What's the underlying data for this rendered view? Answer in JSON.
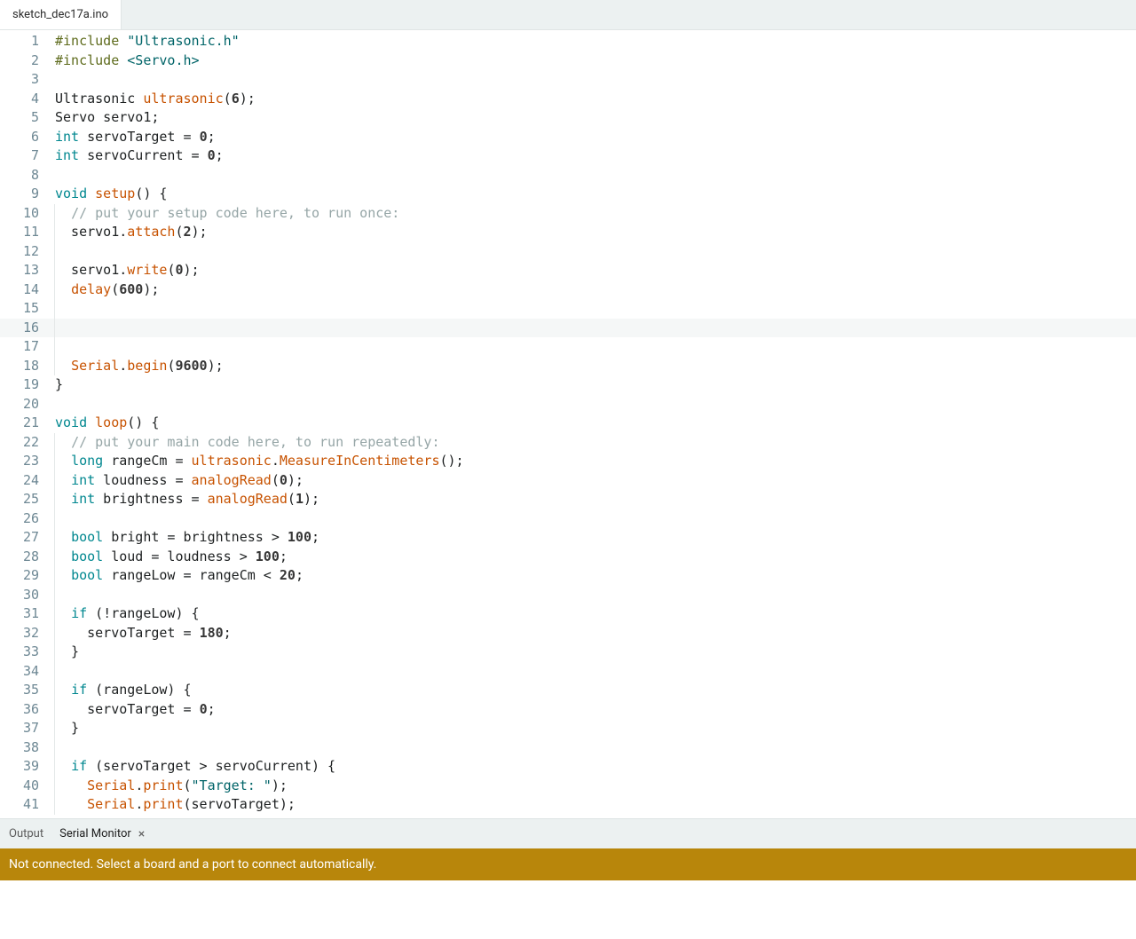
{
  "tab": {
    "filename": "sketch_dec17a.ino"
  },
  "editor": {
    "current_line": 16,
    "lines": [
      {
        "n": 1,
        "tokens": [
          [
            "inc",
            "#include"
          ],
          [
            "op",
            " "
          ],
          [
            "str",
            "\"Ultrasonic.h\""
          ]
        ]
      },
      {
        "n": 2,
        "tokens": [
          [
            "inc",
            "#include"
          ],
          [
            "op",
            " "
          ],
          [
            "str",
            "<Servo.h>"
          ]
        ]
      },
      {
        "n": 3,
        "tokens": []
      },
      {
        "n": 4,
        "tokens": [
          [
            "op",
            "Ultrasonic "
          ],
          [
            "fn",
            "ultrasonic"
          ],
          [
            "op",
            "("
          ],
          [
            "num",
            "6"
          ],
          [
            "op",
            ");"
          ]
        ]
      },
      {
        "n": 5,
        "tokens": [
          [
            "op",
            "Servo servo1;"
          ]
        ]
      },
      {
        "n": 6,
        "tokens": [
          [
            "kw",
            "int"
          ],
          [
            "op",
            " servoTarget = "
          ],
          [
            "num",
            "0"
          ],
          [
            "op",
            ";"
          ]
        ]
      },
      {
        "n": 7,
        "tokens": [
          [
            "kw",
            "int"
          ],
          [
            "op",
            " servoCurrent = "
          ],
          [
            "num",
            "0"
          ],
          [
            "op",
            ";"
          ]
        ]
      },
      {
        "n": 8,
        "tokens": []
      },
      {
        "n": 9,
        "tokens": [
          [
            "kw",
            "void"
          ],
          [
            "op",
            " "
          ],
          [
            "fn",
            "setup"
          ],
          [
            "op",
            "() {"
          ]
        ]
      },
      {
        "n": 10,
        "indent": 1,
        "tokens": [
          [
            "op",
            "  "
          ],
          [
            "cmt",
            "// put your setup code here, to run once:"
          ]
        ]
      },
      {
        "n": 11,
        "indent": 1,
        "tokens": [
          [
            "op",
            "  servo1."
          ],
          [
            "fn",
            "attach"
          ],
          [
            "op",
            "("
          ],
          [
            "num",
            "2"
          ],
          [
            "op",
            ");"
          ]
        ]
      },
      {
        "n": 12,
        "indent": 1,
        "tokens": []
      },
      {
        "n": 13,
        "indent": 1,
        "tokens": [
          [
            "op",
            "  servo1."
          ],
          [
            "fn",
            "write"
          ],
          [
            "op",
            "("
          ],
          [
            "num",
            "0"
          ],
          [
            "op",
            ");"
          ]
        ]
      },
      {
        "n": 14,
        "indent": 1,
        "tokens": [
          [
            "op",
            "  "
          ],
          [
            "fn",
            "delay"
          ],
          [
            "op",
            "("
          ],
          [
            "num",
            "600"
          ],
          [
            "op",
            ");"
          ]
        ]
      },
      {
        "n": 15,
        "indent": 1,
        "tokens": []
      },
      {
        "n": 16,
        "indent": 1,
        "tokens": []
      },
      {
        "n": 17,
        "indent": 1,
        "tokens": []
      },
      {
        "n": 18,
        "indent": 1,
        "tokens": [
          [
            "op",
            "  "
          ],
          [
            "fn",
            "Serial"
          ],
          [
            "op",
            "."
          ],
          [
            "fn",
            "begin"
          ],
          [
            "op",
            "("
          ],
          [
            "num",
            "9600"
          ],
          [
            "op",
            ");"
          ]
        ]
      },
      {
        "n": 19,
        "tokens": [
          [
            "op",
            "}"
          ]
        ]
      },
      {
        "n": 20,
        "tokens": []
      },
      {
        "n": 21,
        "tokens": [
          [
            "kw",
            "void"
          ],
          [
            "op",
            " "
          ],
          [
            "fn",
            "loop"
          ],
          [
            "op",
            "() {"
          ]
        ]
      },
      {
        "n": 22,
        "indent": 1,
        "tokens": [
          [
            "op",
            "  "
          ],
          [
            "cmt",
            "// put your main code here, to run repeatedly:"
          ]
        ]
      },
      {
        "n": 23,
        "indent": 1,
        "tokens": [
          [
            "op",
            "  "
          ],
          [
            "kw",
            "long"
          ],
          [
            "op",
            " rangeCm = "
          ],
          [
            "fn",
            "ultrasonic"
          ],
          [
            "op",
            "."
          ],
          [
            "fn",
            "MeasureInCentimeters"
          ],
          [
            "op",
            "();"
          ]
        ]
      },
      {
        "n": 24,
        "indent": 1,
        "tokens": [
          [
            "op",
            "  "
          ],
          [
            "kw",
            "int"
          ],
          [
            "op",
            " loudness = "
          ],
          [
            "fn",
            "analogRead"
          ],
          [
            "op",
            "("
          ],
          [
            "num",
            "0"
          ],
          [
            "op",
            ");"
          ]
        ]
      },
      {
        "n": 25,
        "indent": 1,
        "tokens": [
          [
            "op",
            "  "
          ],
          [
            "kw",
            "int"
          ],
          [
            "op",
            " brightness = "
          ],
          [
            "fn",
            "analogRead"
          ],
          [
            "op",
            "("
          ],
          [
            "num",
            "1"
          ],
          [
            "op",
            ");"
          ]
        ]
      },
      {
        "n": 26,
        "indent": 1,
        "tokens": []
      },
      {
        "n": 27,
        "indent": 1,
        "tokens": [
          [
            "op",
            "  "
          ],
          [
            "kw",
            "bool"
          ],
          [
            "op",
            " bright = brightness > "
          ],
          [
            "num",
            "100"
          ],
          [
            "op",
            ";"
          ]
        ]
      },
      {
        "n": 28,
        "indent": 1,
        "tokens": [
          [
            "op",
            "  "
          ],
          [
            "kw",
            "bool"
          ],
          [
            "op",
            " loud = loudness > "
          ],
          [
            "num",
            "100"
          ],
          [
            "op",
            ";"
          ]
        ]
      },
      {
        "n": 29,
        "indent": 1,
        "tokens": [
          [
            "op",
            "  "
          ],
          [
            "kw",
            "bool"
          ],
          [
            "op",
            " rangeLow = rangeCm < "
          ],
          [
            "num",
            "20"
          ],
          [
            "op",
            ";"
          ]
        ]
      },
      {
        "n": 30,
        "indent": 1,
        "tokens": []
      },
      {
        "n": 31,
        "indent": 1,
        "tokens": [
          [
            "op",
            "  "
          ],
          [
            "kw",
            "if"
          ],
          [
            "op",
            " (!rangeLow) {"
          ]
        ]
      },
      {
        "n": 32,
        "indent": 2,
        "tokens": [
          [
            "op",
            "    servoTarget = "
          ],
          [
            "num",
            "180"
          ],
          [
            "op",
            ";"
          ]
        ]
      },
      {
        "n": 33,
        "indent": 1,
        "tokens": [
          [
            "op",
            "  }"
          ]
        ]
      },
      {
        "n": 34,
        "indent": 1,
        "tokens": []
      },
      {
        "n": 35,
        "indent": 1,
        "tokens": [
          [
            "op",
            "  "
          ],
          [
            "kw",
            "if"
          ],
          [
            "op",
            " (rangeLow) {"
          ]
        ]
      },
      {
        "n": 36,
        "indent": 2,
        "tokens": [
          [
            "op",
            "    servoTarget = "
          ],
          [
            "num",
            "0"
          ],
          [
            "op",
            ";"
          ]
        ]
      },
      {
        "n": 37,
        "indent": 1,
        "tokens": [
          [
            "op",
            "  }"
          ]
        ]
      },
      {
        "n": 38,
        "indent": 1,
        "tokens": []
      },
      {
        "n": 39,
        "indent": 1,
        "tokens": [
          [
            "op",
            "  "
          ],
          [
            "kw",
            "if"
          ],
          [
            "op",
            " (servoTarget > servoCurrent) {"
          ]
        ]
      },
      {
        "n": 40,
        "indent": 2,
        "tokens": [
          [
            "op",
            "    "
          ],
          [
            "fn",
            "Serial"
          ],
          [
            "op",
            "."
          ],
          [
            "fn",
            "print"
          ],
          [
            "op",
            "("
          ],
          [
            "str",
            "\"Target: \""
          ],
          [
            "op",
            ");"
          ]
        ]
      },
      {
        "n": 41,
        "indent": 2,
        "tokens": [
          [
            "op",
            "    "
          ],
          [
            "fn",
            "Serial"
          ],
          [
            "op",
            "."
          ],
          [
            "fn",
            "print"
          ],
          [
            "op",
            "(servoTarget);"
          ]
        ]
      }
    ]
  },
  "panel": {
    "tabs": {
      "output": "Output",
      "serial": "Serial Monitor"
    },
    "status": "Not connected. Select a board and a port to connect automatically."
  }
}
